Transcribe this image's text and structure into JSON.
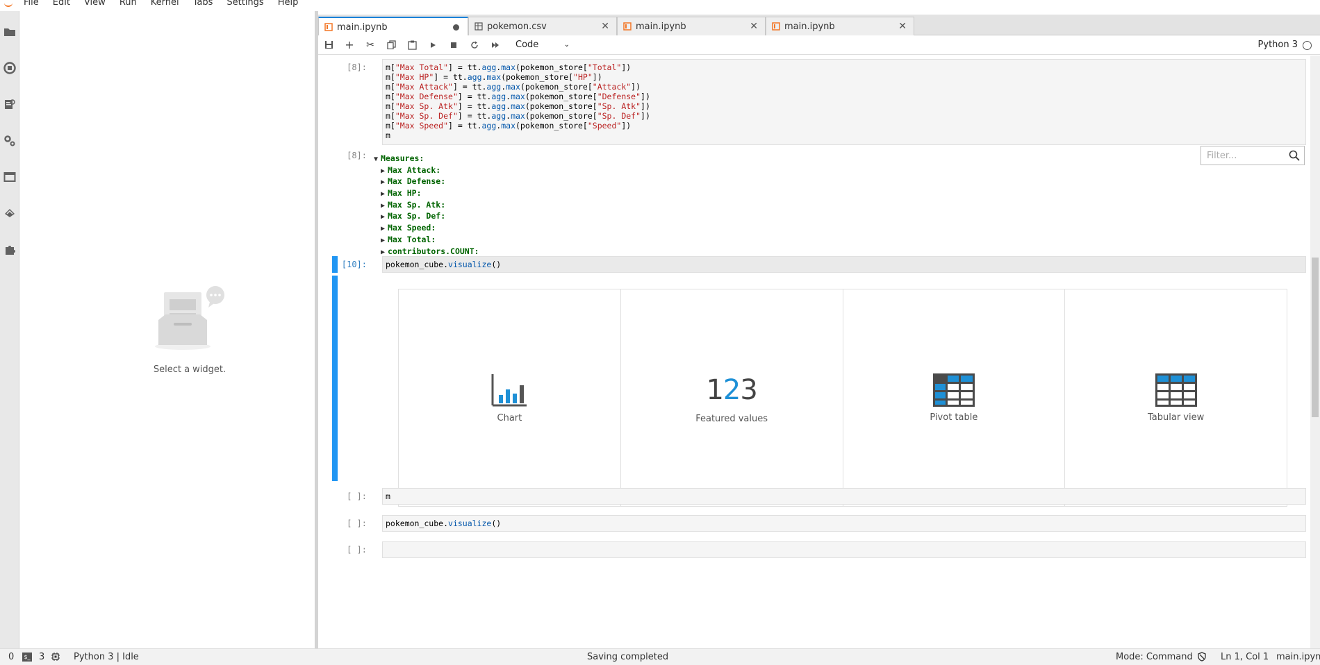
{
  "menu": [
    "File",
    "Edit",
    "View",
    "Run",
    "Kernel",
    "Tabs",
    "Settings",
    "Help"
  ],
  "left_panel": {
    "placeholder": "Select a widget."
  },
  "tabs": [
    {
      "label": "main.ipynb",
      "icon": "notebook-icon",
      "state": "unsaved-dot"
    },
    {
      "label": "pokemon.csv",
      "icon": "table-icon",
      "state": "close"
    },
    {
      "label": "main.ipynb",
      "icon": "notebook-icon",
      "state": "close"
    },
    {
      "label": "main.ipynb",
      "icon": "notebook-icon",
      "state": "close"
    }
  ],
  "toolbar": {
    "cell_type": "Code",
    "kernel": "Python 3"
  },
  "cells": {
    "c8_prompt": "[8]:",
    "c8_code": [
      [
        "m[",
        "\"Max Total\"",
        "] = tt.",
        "agg",
        ".",
        "max",
        "(pokemon_store[",
        "\"Total\"",
        "])"
      ],
      [
        "m[",
        "\"Max HP\"",
        "] = tt.",
        "agg",
        ".",
        "max",
        "(pokemon_store[",
        "\"HP\"",
        "])"
      ],
      [
        "m[",
        "\"Max Attack\"",
        "] = tt.",
        "agg",
        ".",
        "max",
        "(pokemon_store[",
        "\"Attack\"",
        "])"
      ],
      [
        "m[",
        "\"Max Defense\"",
        "] = tt.",
        "agg",
        ".",
        "max",
        "(pokemon_store[",
        "\"Defense\"",
        "])"
      ],
      [
        "m[",
        "\"Max Sp. Atk\"",
        "] = tt.",
        "agg",
        ".",
        "max",
        "(pokemon_store[",
        "\"Sp. Atk\"",
        "])"
      ],
      [
        "m[",
        "\"Max Sp. Def\"",
        "] = tt.",
        "agg",
        ".",
        "max",
        "(pokemon_store[",
        "\"Sp. Def\"",
        "])"
      ],
      [
        "m[",
        "\"Max Speed\"",
        "] = tt.",
        "agg",
        ".",
        "max",
        "(pokemon_store[",
        "\"Speed\"",
        "])"
      ],
      [
        "m"
      ]
    ],
    "out8_prompt": "[8]:",
    "measures_title": "Measures:",
    "measures": [
      "Max Attack:",
      "Max Defense:",
      "Max HP:",
      "Max Sp. Atk:",
      "Max Sp. Def:",
      "Max Speed:",
      "Max Total:",
      "contributors.COUNT:"
    ],
    "filter_placeholder": "Filter...",
    "c10_prompt": "[10]:",
    "c10_code_obj": "pokemon_cube.",
    "c10_code_fn": "visualize",
    "c10_code_end": "()",
    "widgets": [
      {
        "label": "Chart",
        "icon": "bar-chart-icon"
      },
      {
        "label": "Featured values",
        "icon": "featured-values-icon"
      },
      {
        "label": "Pivot table",
        "icon": "pivot-table-icon"
      },
      {
        "label": "Tabular view",
        "icon": "tabular-view-icon"
      }
    ],
    "featured_num": {
      "d1": "1",
      "d2": "2",
      "d3": "3"
    },
    "c_empty1_prompt": "[ ]:",
    "c_empty1_code": "m",
    "c_empty2_prompt": "[ ]:",
    "c_empty2_code_obj": "pokemon_cube.",
    "c_empty2_code_fn": "visualize",
    "c_empty2_code_end": "()",
    "c_empty3_prompt": "[ ]:"
  },
  "status": {
    "left_num1": "0",
    "left_num2": "3",
    "kernel_state": "Python 3 | Idle",
    "center": "Saving completed",
    "mode": "Mode: Command",
    "position": "Ln 1, Col 1",
    "file": "main.ipynb"
  },
  "colors": {
    "accent": "#2196f3",
    "string": "#ba2121",
    "measures": "#006400"
  }
}
